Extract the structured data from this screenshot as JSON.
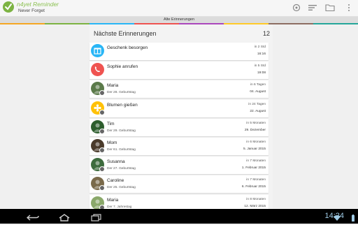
{
  "app": {
    "title": "n4yet Reminder",
    "subtitle": "Never Forget",
    "brand_color": "#7cb342"
  },
  "actionbar": {
    "icons": [
      "sync-icon",
      "sort-icon",
      "folder-icon",
      "overflow-menu-icon"
    ]
  },
  "tabs": {
    "active_label": "Alte Erinnerungen"
  },
  "color_strip": [
    "#f5a623",
    "#7cb342",
    "#29b6f6",
    "#ef5350",
    "#ab47bc",
    "#ffca28",
    "#8d6e63",
    "#26a69a"
  ],
  "section": {
    "title": "Nächste Erinnerungen",
    "count": "12"
  },
  "reminders": [
    {
      "name": "Geschenk besorgen",
      "subtitle": "",
      "when": "in 2 Std",
      "date": "16:16",
      "icon": "gift-icon",
      "color": "#29b6f6"
    },
    {
      "name": "Sophie anrufen",
      "subtitle": "",
      "when": "in 5 Std",
      "date": "19:08",
      "icon": "phone-icon",
      "color": "#ef5350"
    },
    {
      "name": "Maria",
      "subtitle": "Der 28. Geburtstag",
      "when": "in 6 Tagen",
      "date": "04. August",
      "icon": "contact-photo",
      "color": "#5b7a4a"
    },
    {
      "name": "Blumen gießen",
      "subtitle": "",
      "when": "in 24 Tagen",
      "date": "22. August",
      "icon": "flower-icon",
      "color": "#ffc107"
    },
    {
      "name": "Tim",
      "subtitle": "Der 29. Geburtstag",
      "when": "in 5 Monaten",
      "date": "29. Dezember",
      "icon": "contact-photo",
      "color": "#2e5e2e"
    },
    {
      "name": "Mom",
      "subtitle": "Der 61. Geburtstag",
      "when": "in 6 Monaten",
      "date": "5. Januar 2015",
      "icon": "contact-photo",
      "color": "#4a3a2a"
    },
    {
      "name": "Susanna",
      "subtitle": "Der 27. Geburtstag",
      "when": "in 7 Monaten",
      "date": "1. Februar 2015",
      "icon": "contact-photo",
      "color": "#3d6b3d"
    },
    {
      "name": "Caroline",
      "subtitle": "Der 25. Geburtstag",
      "when": "in 7 Monaten",
      "date": "6. Februar 2015",
      "icon": "contact-photo",
      "color": "#7a6a4a"
    },
    {
      "name": "Maria",
      "subtitle": "Der 7. Jahrestag",
      "when": "in 8 Monaten",
      "date": "12. März 2015",
      "icon": "contact-photo",
      "color": "#8aa86a"
    }
  ],
  "navbar": {
    "clock": "14:24",
    "buttons": [
      "back-icon",
      "home-icon",
      "recents-icon"
    ],
    "status_icons": [
      "wifi-icon",
      "battery-icon"
    ]
  }
}
